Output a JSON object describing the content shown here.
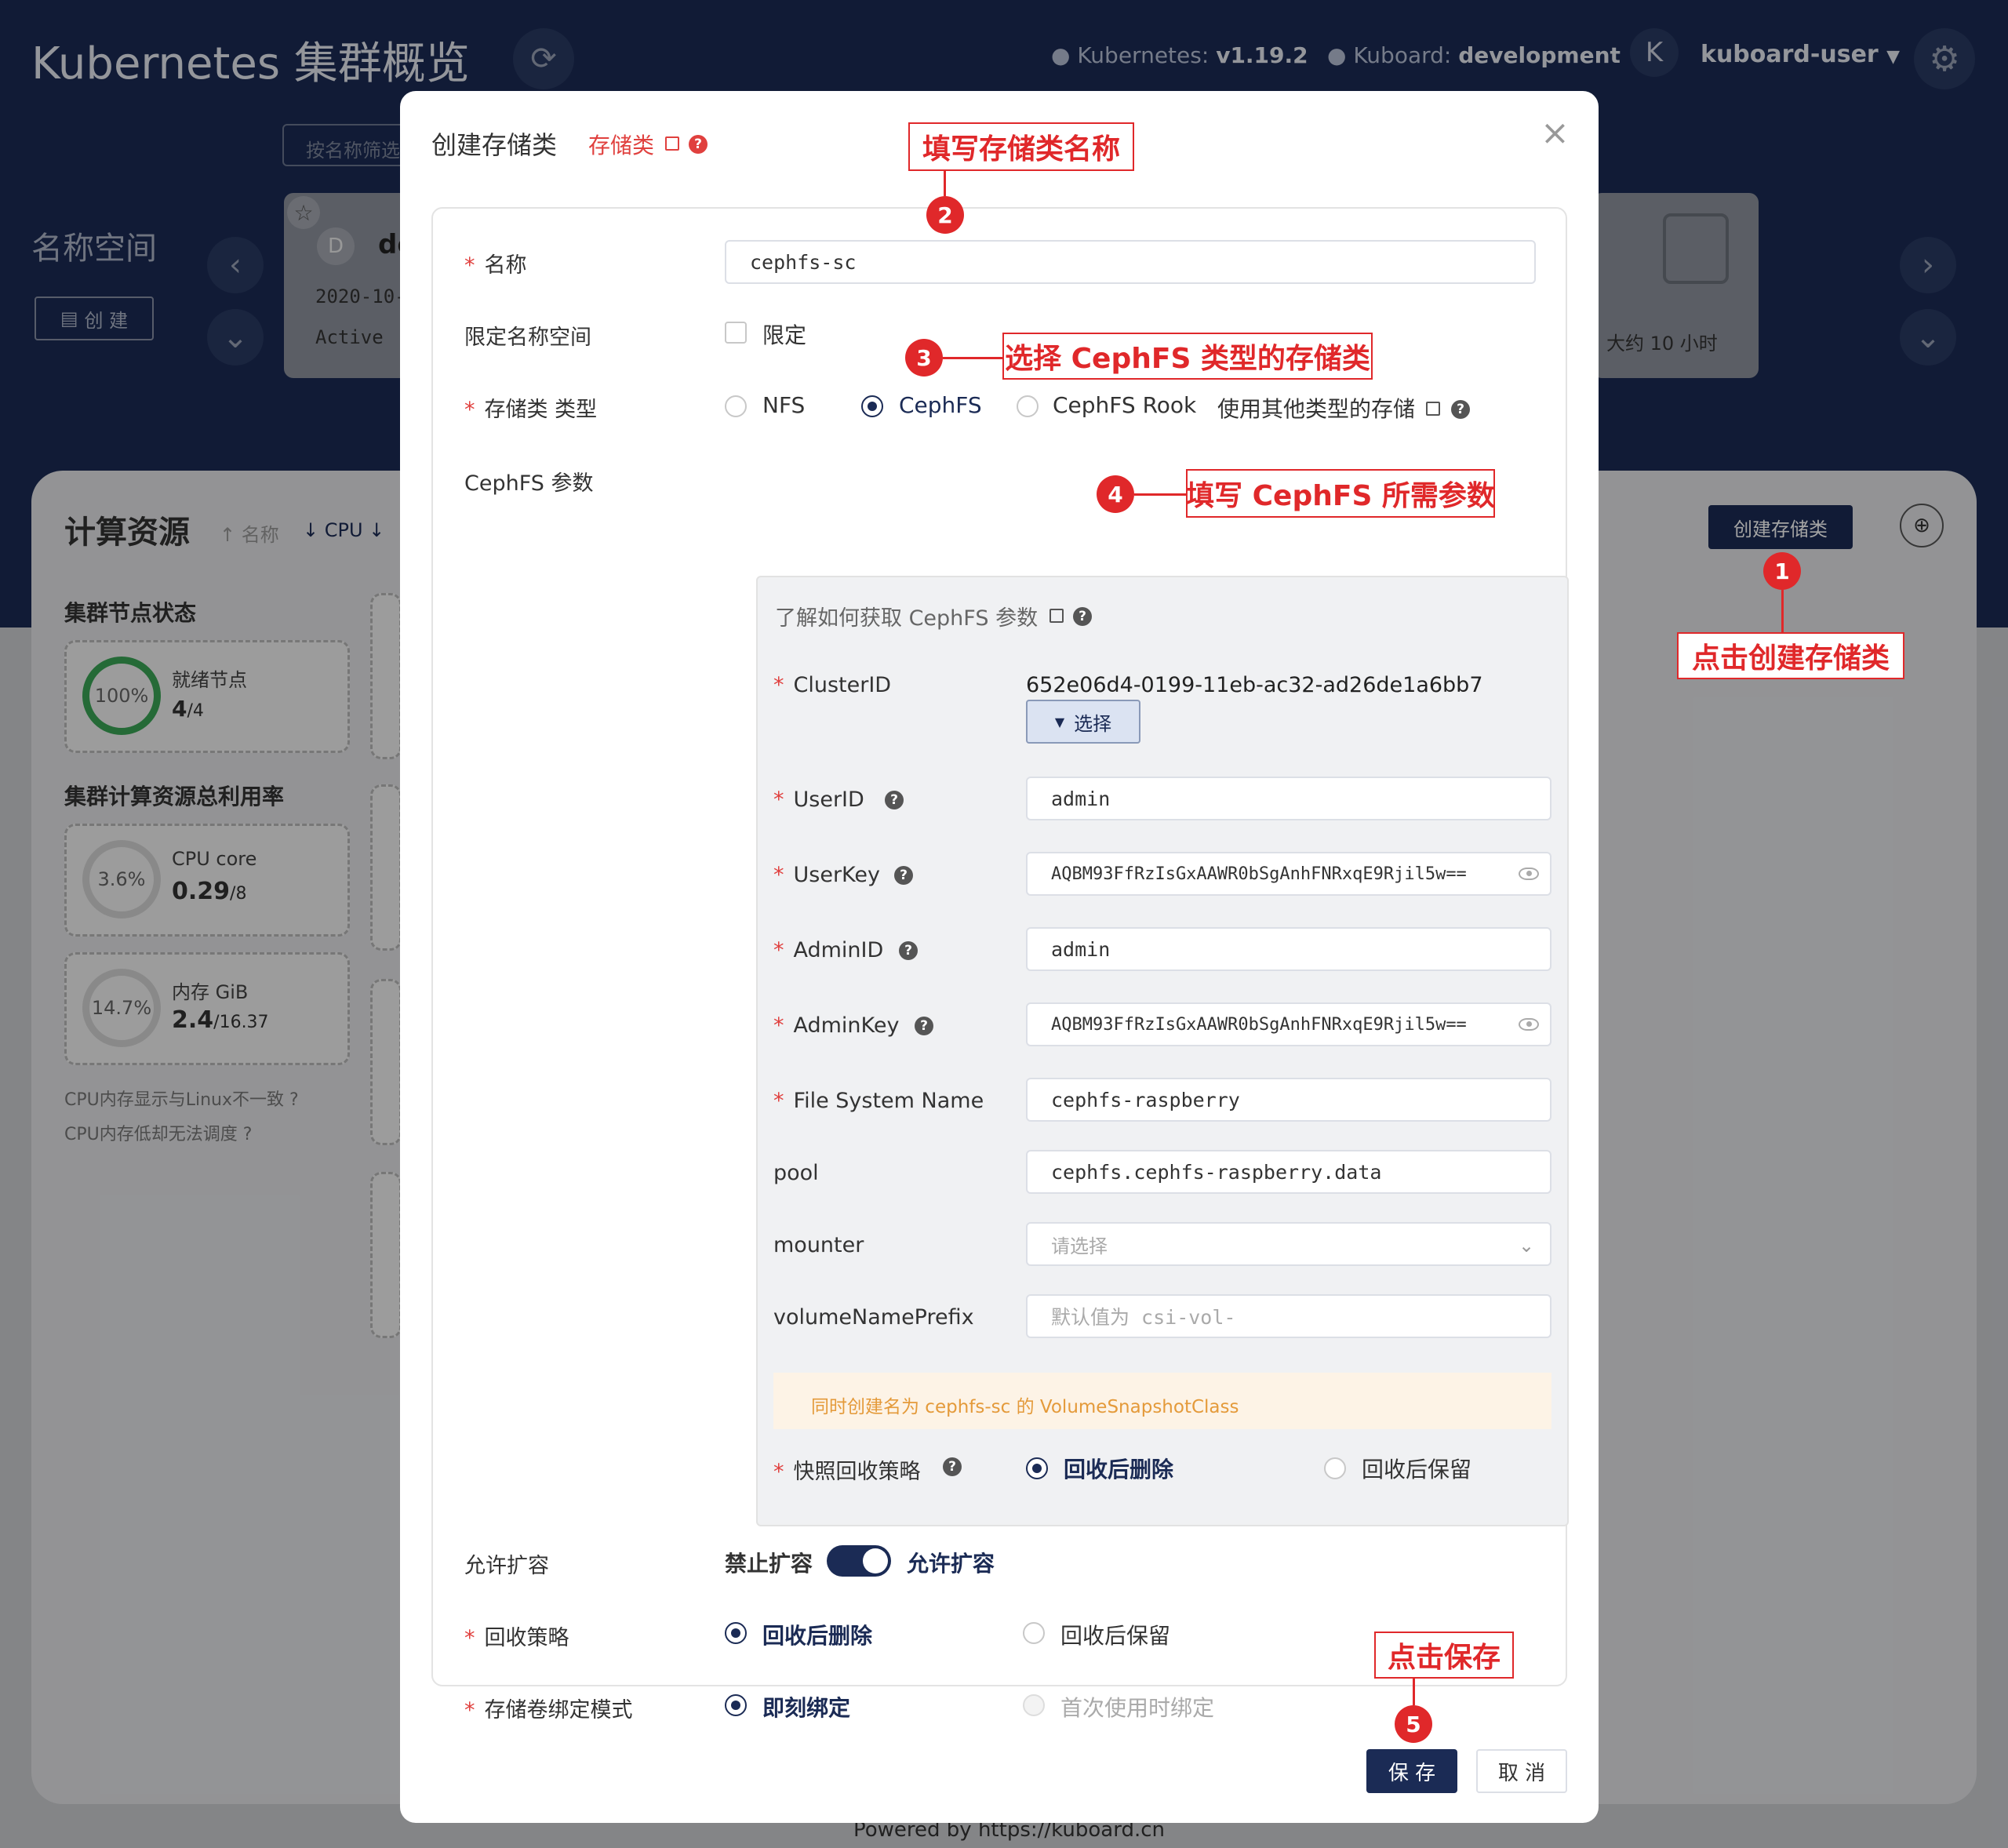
{
  "header": {
    "title": "Kubernetes 集群概览",
    "k8s_label": "Kubernetes:",
    "k8s_version": "v1.19.2",
    "kuboard_label": "Kuboard:",
    "kuboard_env": "development",
    "avatar_letter": "K",
    "user": "kuboard-user",
    "filter_placeholder": "按名称筛选"
  },
  "namespace": {
    "title": "名称空间",
    "create_label": "创 建",
    "card_avatar": "D",
    "card_name": "de",
    "card_date": "2020-10-",
    "card_status": "Active",
    "right_time": "大约 10 小时"
  },
  "compute": {
    "title": "计算资源",
    "sort_name": "名称",
    "sort_cpu": "CPU",
    "create_storage_button": "创建存储类",
    "node_status_title": "集群节点状态",
    "ready_percent": "100%",
    "ready_label": "就绪节点",
    "ready_value": "4",
    "ready_total": "/4",
    "usage_title": "集群计算资源总利用率",
    "cpu_percent": "3.6%",
    "cpu_label": "CPU core",
    "cpu_value": "0.29",
    "cpu_total": "/8",
    "mem_percent": "14.7%",
    "mem_label": "内存 GiB",
    "mem_value": "2.4",
    "mem_total": "/16.37",
    "note1": "CPU内存显示与Linux不一致",
    "note2": "CPU内存低却无法调度"
  },
  "footer": {
    "powered": "Powered by https://kuboard.cn"
  },
  "modal": {
    "title": "创建存储类",
    "doc_link": "存储类",
    "name_label": "名称",
    "name_value": "cephfs-sc",
    "limit_ns_label": "限定名称空间",
    "limit_ns_checkbox": "限定",
    "type_label": "存储类 类型",
    "type_options": [
      "NFS",
      "CephFS",
      "CephFS Rook"
    ],
    "type_other": "使用其他类型的存储",
    "cephfs_params_label": "CephFS 参数",
    "params_help": "了解如何获取 CephFS 参数",
    "cluster_id_label": "ClusterID",
    "cluster_id_value": "652e06d4-0199-11eb-ac32-ad26de1a6bb7",
    "select_button": "选择",
    "user_id_label": "UserID",
    "user_id_value": "admin",
    "user_key_label": "UserKey",
    "user_key_value": "AQBM93FfRzIsGxAAWR0bSgAnhFNRxqE9Rjil5w==",
    "admin_id_label": "AdminID",
    "admin_id_value": "admin",
    "admin_key_label": "AdminKey",
    "admin_key_value": "AQBM93FfRzIsGxAAWR0bSgAnhFNRxqE9Rjil5w==",
    "fs_name_label": "File System Name",
    "fs_name_value": "cephfs-raspberry",
    "pool_label": "pool",
    "pool_value": "cephfs.cephfs-raspberry.data",
    "mounter_label": "mounter",
    "mounter_placeholder": "请选择",
    "prefix_label": "volumeNamePrefix",
    "prefix_placeholder": "默认值为 csi-vol-",
    "snapshot_notice": "同时创建名为 cephfs-sc 的 VolumeSnapshotClass",
    "snapshot_policy_label": "快照回收策略",
    "snapshot_policy_options": [
      "回收后删除",
      "回收后保留"
    ],
    "expand_label": "允许扩容",
    "expand_off": "禁止扩容",
    "expand_on": "允许扩容",
    "reclaim_label": "回收策略",
    "reclaim_options": [
      "回收后删除",
      "回收后保留"
    ],
    "binding_label": "存储卷绑定模式",
    "binding_options": [
      "即刻绑定",
      "首次使用时绑定"
    ],
    "save_button": "保 存",
    "cancel_button": "取 消",
    "close_symbol": "×"
  },
  "annotations": [
    {
      "num": "1",
      "text": "点击创建存储类"
    },
    {
      "num": "2",
      "text": "填写存储类名称"
    },
    {
      "num": "3",
      "text": "选择 CephFS 类型的存储类"
    },
    {
      "num": "4",
      "text": "填写 CephFS 所需参数"
    },
    {
      "num": "5",
      "text": "点击保存"
    }
  ],
  "colors": {
    "navy": "#1b2b55",
    "accent_red": "#e0282a",
    "notice_bg": "#fdf3e6",
    "notice_text": "#e49a3a",
    "green": "#3aa757"
  }
}
